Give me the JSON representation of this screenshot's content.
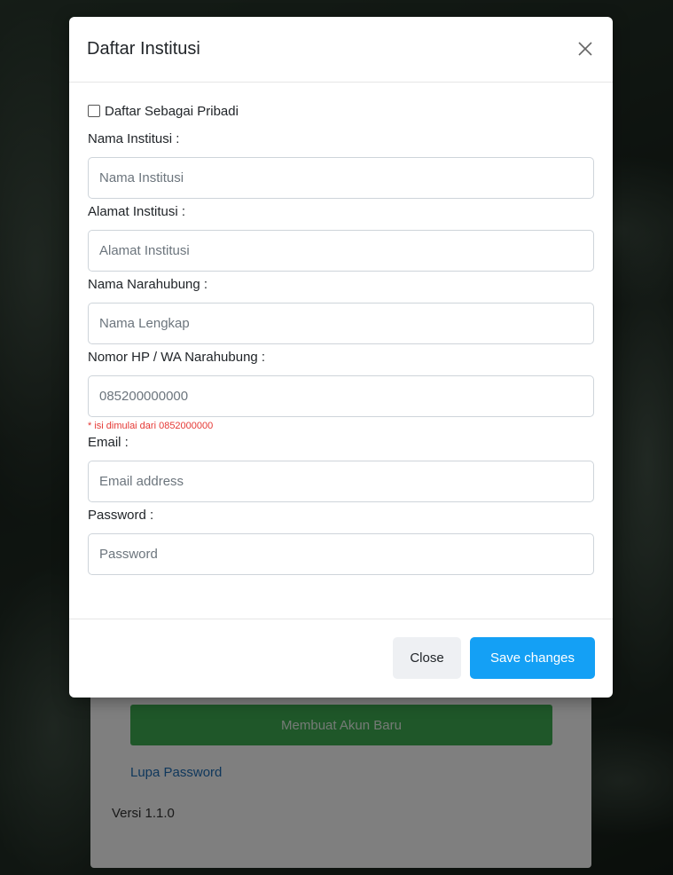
{
  "background_login": {
    "new_account_button": "Membuat Akun Baru",
    "forgot_password_link": "Lupa Password",
    "version": "Versi 1.1.0"
  },
  "modal": {
    "title": "Daftar Institusi",
    "close_icon": "close-icon",
    "personal_checkbox_label": "Daftar Sebagai Pribadi",
    "fields": {
      "institution_name": {
        "label": "Nama Institusi :",
        "placeholder": "Nama Institusi"
      },
      "institution_address": {
        "label": "Alamat Institusi :",
        "placeholder": "Alamat Institusi"
      },
      "contact_name": {
        "label": "Nama Narahubung :",
        "placeholder": "Nama Lengkap"
      },
      "contact_phone": {
        "label": "Nomor HP / WA Narahubung :",
        "placeholder": "085200000000",
        "hint": "* isi dimulai dari 0852000000"
      },
      "email": {
        "label": "Email :",
        "placeholder": "Email address"
      },
      "password": {
        "label": "Password :",
        "placeholder": "Password"
      }
    },
    "footer": {
      "close_label": "Close",
      "save_label": "Save changes"
    }
  },
  "colors": {
    "primary": "#14a0f5",
    "success": "#3fae53",
    "hint_red": "#e53935"
  }
}
